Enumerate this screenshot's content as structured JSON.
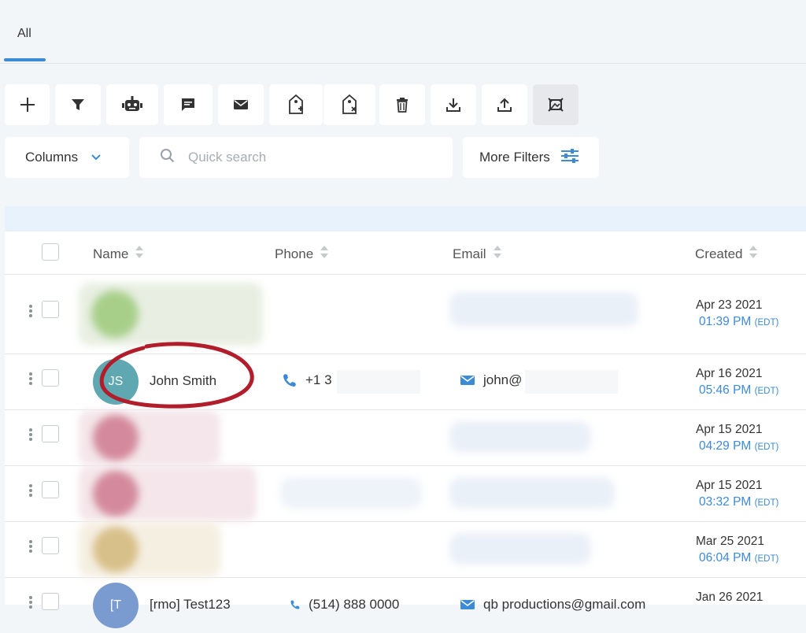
{
  "tabs": [
    {
      "label": "All",
      "active": true
    }
  ],
  "toolbar": {
    "buttons": [
      {
        "name": "add-icon"
      },
      {
        "name": "filter-icon"
      },
      {
        "name": "robot-icon"
      },
      {
        "name": "message-icon"
      },
      {
        "name": "email-icon"
      },
      {
        "name": "add-tag-icon"
      },
      {
        "name": "remove-tag-icon"
      },
      {
        "name": "trash-icon"
      },
      {
        "name": "download-icon"
      },
      {
        "name": "upload-icon"
      },
      {
        "name": "layout-icon"
      }
    ]
  },
  "controls": {
    "columns_label": "Columns",
    "search_placeholder": "Quick search",
    "more_filters_label": "More Filters"
  },
  "table": {
    "headers": {
      "name": "Name",
      "phone": "Phone",
      "email": "Email",
      "created": "Created"
    },
    "rows": [
      {
        "avatar_color": "#a8cf8a",
        "name": "",
        "phone": "",
        "email": "",
        "date": "Apr 23 2021",
        "time": "01:39 PM",
        "tz": "(EDT)"
      },
      {
        "initials": "JS",
        "avatar_color": "#5fa8b2",
        "name": "John Smith",
        "phone": "+1 3",
        "email": "john@",
        "date": "Apr 16 2021",
        "time": "05:46 PM",
        "tz": "(EDT)"
      },
      {
        "avatar_color": "#d48a9c",
        "name": "",
        "phone": "",
        "email": "",
        "date": "Apr 15 2021",
        "time": "04:29 PM",
        "tz": "(EDT)"
      },
      {
        "avatar_color": "#d48a9c",
        "name": "",
        "phone": "",
        "email": "",
        "date": "Apr 15 2021",
        "time": "03:32 PM",
        "tz": "(EDT)"
      },
      {
        "avatar_color": "#d8c08a",
        "name": "",
        "phone": "",
        "email": "",
        "date": "Mar 25 2021",
        "time": "06:04 PM",
        "tz": "(EDT)"
      },
      {
        "initials": "[T",
        "avatar_color": "#7a9bd0",
        "name": "[rmo] Test123",
        "phone": "(514) 888 0000",
        "email": "qb productions@gmail.com",
        "date": "Jan 26 2021",
        "time": "",
        "tz": ""
      }
    ]
  },
  "colors": {
    "accent": "#3d8ad6",
    "annotation": "#b11d2b"
  }
}
